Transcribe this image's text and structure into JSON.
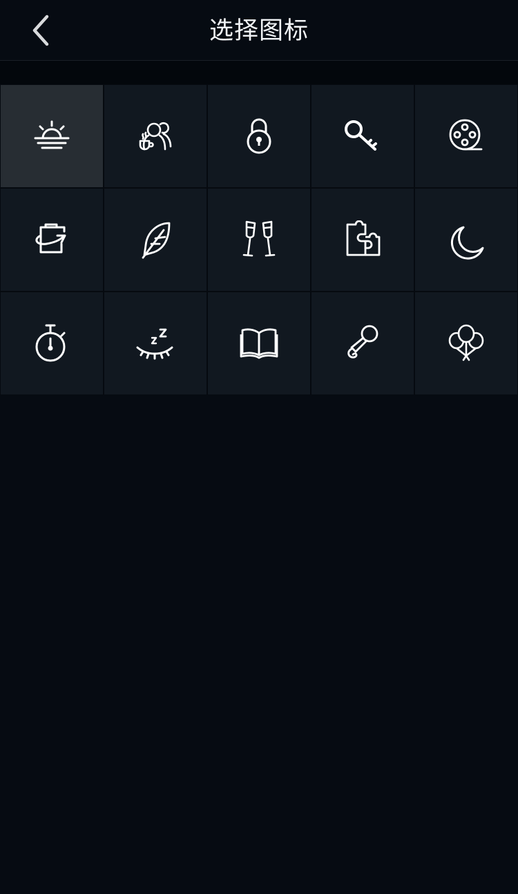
{
  "header": {
    "title": "选择图标",
    "back_icon": "chevron-left-icon"
  },
  "icons": [
    {
      "name": "sunrise-icon",
      "selected": true
    },
    {
      "name": "coffee-people-icon",
      "selected": false
    },
    {
      "name": "padlock-icon",
      "selected": false
    },
    {
      "name": "key-icon",
      "selected": false
    },
    {
      "name": "film-reel-icon",
      "selected": false
    },
    {
      "name": "cup-arrow-icon",
      "selected": false
    },
    {
      "name": "feather-icon",
      "selected": false
    },
    {
      "name": "champagne-glasses-icon",
      "selected": false
    },
    {
      "name": "puzzle-icon",
      "selected": false
    },
    {
      "name": "moon-icon",
      "selected": false
    },
    {
      "name": "stopwatch-icon",
      "selected": false
    },
    {
      "name": "sleep-eye-icon",
      "selected": false
    },
    {
      "name": "open-book-icon",
      "selected": false
    },
    {
      "name": "microphone-icon",
      "selected": false
    },
    {
      "name": "balloons-icon",
      "selected": false
    }
  ],
  "colors": {
    "background": "#060b12",
    "cell": "#111820",
    "cell_selected": "#272d33",
    "icon_stroke": "#ffffff",
    "title": "#f2f4f6"
  }
}
